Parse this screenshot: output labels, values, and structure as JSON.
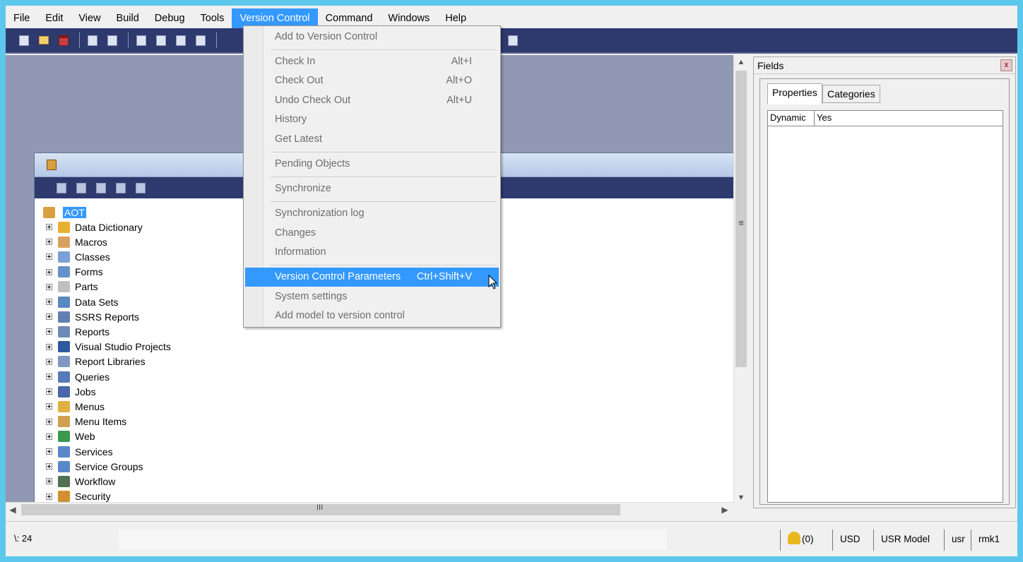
{
  "menubar": {
    "items": [
      "File",
      "Edit",
      "View",
      "Build",
      "Debug",
      "Tools",
      "Version Control",
      "Command",
      "Windows",
      "Help"
    ],
    "active_index": 6
  },
  "version_control_menu": {
    "add_to_version_control": "Add to Version Control",
    "check_in": {
      "label": "Check In",
      "shortcut": "Alt+I"
    },
    "check_out": {
      "label": "Check Out",
      "shortcut": "Alt+O"
    },
    "undo_check_out": {
      "label": "Undo Check Out",
      "shortcut": "Alt+U"
    },
    "history": "History",
    "get_latest": "Get Latest",
    "pending_objects": "Pending Objects",
    "synchronize": "Synchronize",
    "synchronization_log": "Synchronization log",
    "changes": "Changes",
    "information": "Information",
    "version_control_parameters": {
      "label": "Version Control Parameters",
      "shortcut": "Ctrl+Shift+V"
    },
    "system_settings": "System settings",
    "add_model": "Add model to version control"
  },
  "aot": {
    "root_label": "AOT",
    "nodes": [
      {
        "label": "Data Dictionary",
        "icon": "data-dictionary-icon",
        "color": "#e8b030"
      },
      {
        "label": "Macros",
        "icon": "macros-icon",
        "color": "#d8a060"
      },
      {
        "label": "Classes",
        "icon": "classes-icon",
        "color": "#7aa0d8"
      },
      {
        "label": "Forms",
        "icon": "forms-icon",
        "color": "#6890c8"
      },
      {
        "label": "Parts",
        "icon": "parts-icon",
        "color": "#c0c0c0"
      },
      {
        "label": "Data Sets",
        "icon": "data-sets-icon",
        "color": "#5a88c0"
      },
      {
        "label": "SSRS Reports",
        "icon": "ssrs-reports-icon",
        "color": "#6080b0"
      },
      {
        "label": "Reports",
        "icon": "reports-icon",
        "color": "#7088b8"
      },
      {
        "label": "Visual Studio Projects",
        "icon": "visual-studio-projects-icon",
        "color": "#3058a0"
      },
      {
        "label": "Report Libraries",
        "icon": "report-libraries-icon",
        "color": "#8098c0"
      },
      {
        "label": "Queries",
        "icon": "queries-icon",
        "color": "#5878b8"
      },
      {
        "label": "Jobs",
        "icon": "jobs-icon",
        "color": "#4868a8"
      },
      {
        "label": "Menus",
        "icon": "menus-icon",
        "color": "#e0b040"
      },
      {
        "label": "Menu Items",
        "icon": "menu-items-icon",
        "color": "#d0a050"
      },
      {
        "label": "Web",
        "icon": "web-icon",
        "color": "#3a9a50"
      },
      {
        "label": "Services",
        "icon": "services-icon",
        "color": "#5888c8"
      },
      {
        "label": "Service Groups",
        "icon": "service-groups-icon",
        "color": "#5888c8"
      },
      {
        "label": "Workflow",
        "icon": "workflow-icon",
        "color": "#507050"
      },
      {
        "label": "Security",
        "icon": "security-icon",
        "color": "#d09030"
      }
    ]
  },
  "properties_pane": {
    "title": "Fields",
    "close_glyph": "x",
    "tabs": [
      "Properties",
      "Categories"
    ],
    "selected_tab": 0,
    "rows": [
      {
        "key": "Dynamic",
        "value": "Yes"
      }
    ]
  },
  "scrollbar_grips": {
    "vertical": "≡",
    "horizontal": "III"
  },
  "statusbar": {
    "left_text": "\\: 24",
    "notifications": "(0)",
    "currency": "USD",
    "model": "USR Model",
    "layer": "usr",
    "company": "rmk1"
  },
  "colors": {
    "accent": "#3399ff",
    "toolbar_bg": "#2e3a6e",
    "workspace_bg": "#9098b4",
    "desktop_bg": "#5ec8ec"
  }
}
